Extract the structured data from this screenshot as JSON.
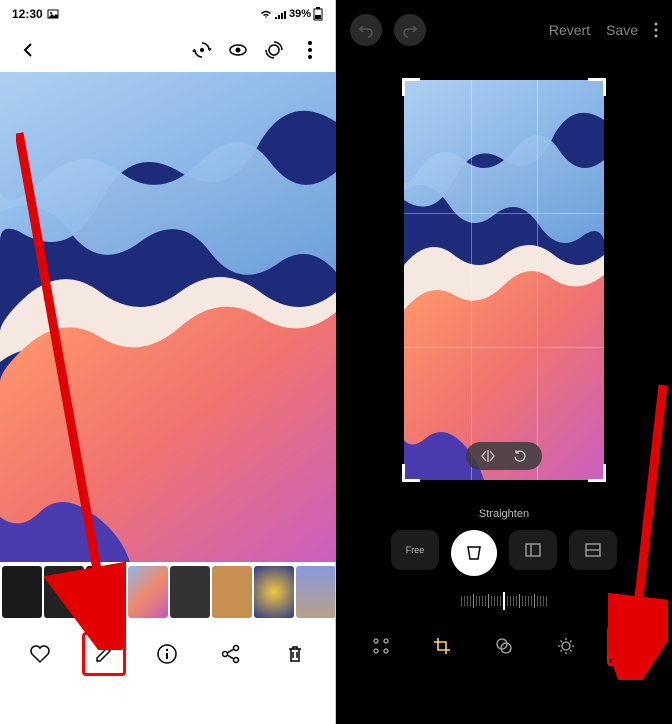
{
  "left": {
    "status": {
      "time": "12:30",
      "battery": "39%"
    },
    "thumbnails_count": 8
  },
  "editor": {
    "actions": {
      "revert": "Revert",
      "save": "Save"
    },
    "straighten_label": "Straighten",
    "free_label": "Free"
  },
  "icons": {
    "picture": "picture-icon",
    "wifi": "wifi-icon",
    "signal": "signal-icon",
    "battery": "battery-icon"
  }
}
